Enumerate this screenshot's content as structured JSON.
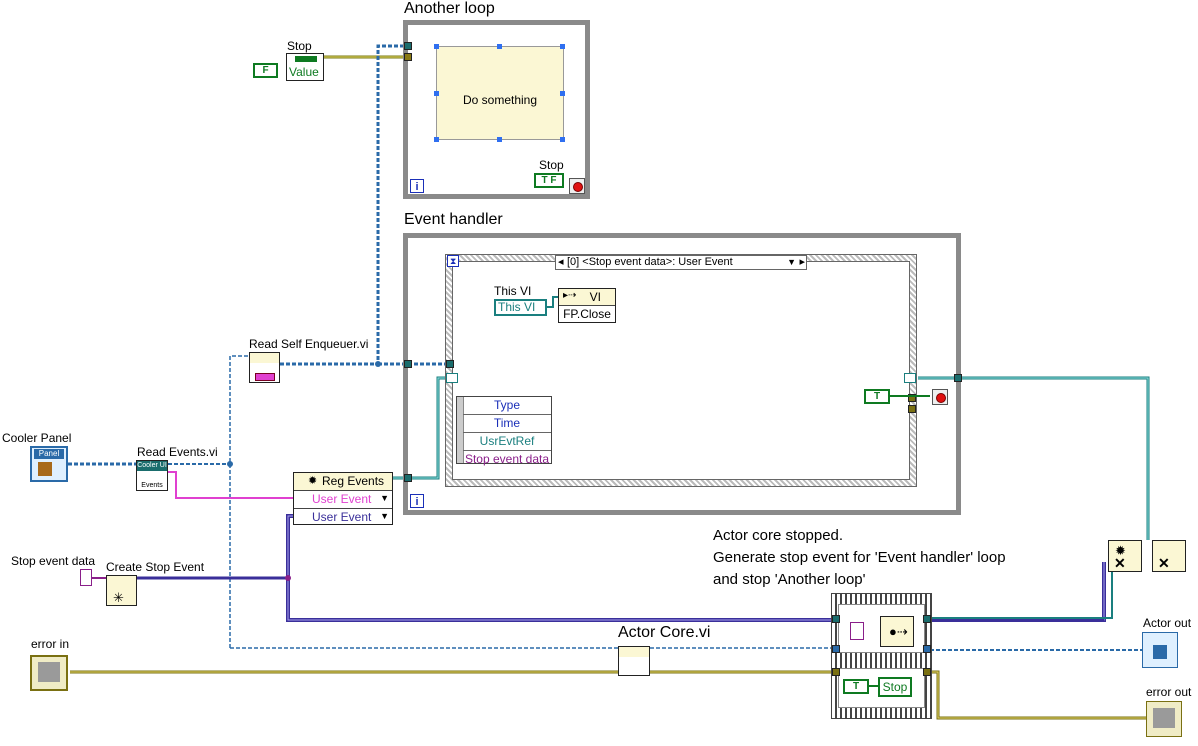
{
  "loops": {
    "another_loop_title": "Another loop",
    "event_handler_title": "Event handler",
    "iteration_glyph": "i"
  },
  "another_loop": {
    "subdiagram_text": "Do something",
    "stop_label": "Stop",
    "stop_constant": "T F"
  },
  "stop_node": {
    "label": "Stop",
    "property": "Value",
    "constant": "F"
  },
  "event_structure": {
    "case_selector": "[0] <Stop event data>: User Event",
    "this_vi_label": "This VI",
    "this_vi_ref": "This VI",
    "invoke_header": "VI",
    "invoke_method": "FP.Close",
    "event_data": [
      "Type",
      "Time",
      "UsrEvtRef",
      "Stop event data"
    ],
    "stop_constant": "T"
  },
  "nodes": {
    "read_self_enqueuer": "Read Self Enqueuer.vi",
    "cooler_panel": "Cooler Panel",
    "cooler_panel_icon_text": "Panel",
    "read_events": "Read Events.vi",
    "read_events_header": "Cooler UI",
    "read_events_sub": "Events",
    "reg_events_title": "Reg Events",
    "reg_events_items": [
      "User Event",
      "User Event"
    ],
    "stop_event_data": "Stop event data",
    "create_stop_event": "Create Stop Event",
    "error_in": "error in",
    "actor_core": "Actor Core.vi",
    "actor_out": "Actor out",
    "error_out": "error out",
    "actor_stop_constant": "T",
    "actor_stop_control": "Stop"
  },
  "comment": {
    "text": "Actor core stopped.\nGenerate stop event for 'Event handler' loop\nand stop 'Another loop'"
  },
  "colors": {
    "loop_border": "#8a8a8a",
    "enqueuer_wire": "#2a6aa8",
    "event_wire": "#1a7f7f",
    "error_wire": "#b4a51d",
    "user_event_wire": "#3a2f9a",
    "stop_data_wire": "#8a1f8a",
    "boolean": "#0e7a21",
    "pink_wire": "#e040d0",
    "subdiagram_fill": "#fbf7d4"
  }
}
